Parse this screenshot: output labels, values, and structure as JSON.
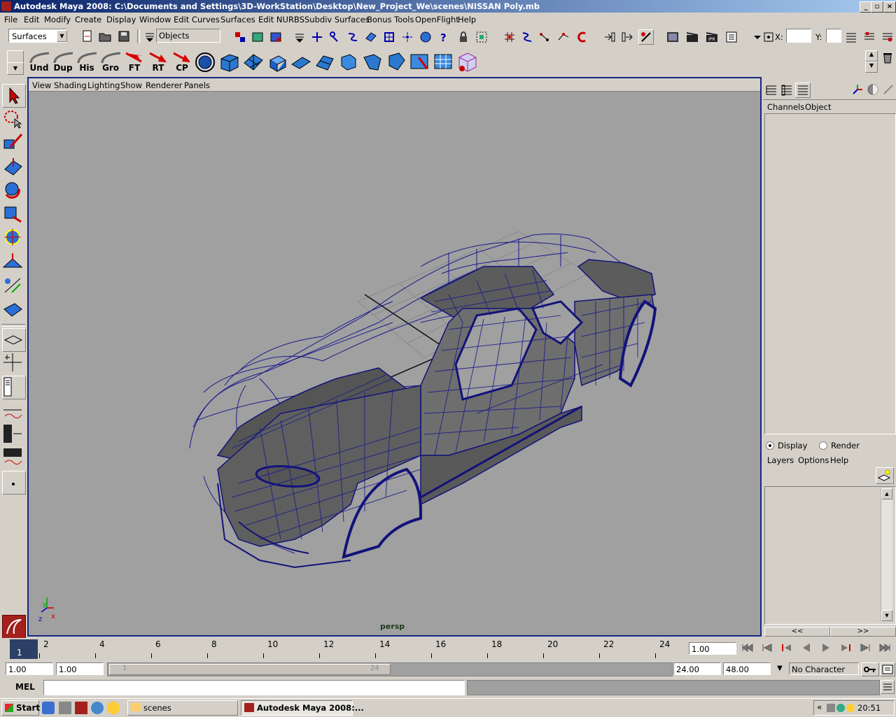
{
  "window": {
    "title": "Autodesk Maya 2008: C:\\Documents and Settings\\3D-WorkStation\\Desktop\\New_Project_We\\scenes\\NISSAN Poly.mb",
    "minimize": "_",
    "maximize": "▫",
    "close": "×"
  },
  "menu": [
    "File",
    "Edit",
    "Modify",
    "Create",
    "Display",
    "Window",
    "Edit Curves",
    "Surfaces",
    "Edit NURBS",
    "Subdiv Surfaces",
    "Bonus Tools",
    "OpenFlight",
    "Help"
  ],
  "statusline": {
    "menuset": "Surfaces",
    "selection_mode": "Objects",
    "x_label": "X:",
    "y_label": "Y:"
  },
  "shelf": {
    "buttons": [
      "Und",
      "Dup",
      "His",
      "Gro",
      "FT",
      "RT",
      "CP"
    ]
  },
  "viewport": {
    "menu": [
      "View",
      "Shading",
      "Lighting",
      "Show",
      "Renderer",
      "Panels"
    ],
    "camera": "persp",
    "axis_x": "x",
    "axis_y": "y",
    "axis_z": "z"
  },
  "channelbox": {
    "tabs": [
      "Channels",
      "Object"
    ],
    "layer_modes": [
      "Display",
      "Render"
    ],
    "layer_menu": [
      "Layers",
      "Options",
      "Help"
    ],
    "scroll_left": "<<",
    "scroll_right": ">>"
  },
  "timeslider": {
    "current_frame": "1",
    "ticks": [
      "2",
      "4",
      "6",
      "8",
      "10",
      "12",
      "14",
      "16",
      "18",
      "20",
      "22",
      "24"
    ],
    "current_time": "1.00"
  },
  "rangeslider": {
    "start_time": "1.00",
    "playback_start": "1.00",
    "bar_start": "1",
    "bar_end": "24",
    "playback_end": "24.00",
    "end_time": "48.00",
    "character_set": "No Character Set"
  },
  "commandline": {
    "label": "MEL"
  },
  "taskbar": {
    "start": "Start",
    "tasks": [
      "scenes",
      "Autodesk Maya 2008:..."
    ],
    "clock": "20:51"
  }
}
